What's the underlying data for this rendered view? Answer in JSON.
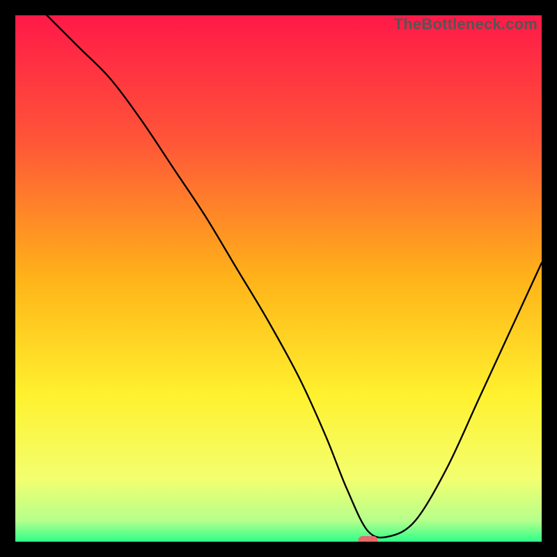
{
  "watermark": "TheBottleneck.com",
  "chart_data": {
    "type": "line",
    "title": "",
    "xlabel": "",
    "ylabel": "",
    "xlim": [
      0,
      100
    ],
    "ylim": [
      0,
      100
    ],
    "grid": false,
    "legend": false,
    "background_gradient_stops": [
      {
        "offset": 0.0,
        "color": "#ff1948"
      },
      {
        "offset": 0.24,
        "color": "#ff5638"
      },
      {
        "offset": 0.5,
        "color": "#ffb319"
      },
      {
        "offset": 0.72,
        "color": "#fff12e"
      },
      {
        "offset": 0.88,
        "color": "#f3ff6f"
      },
      {
        "offset": 0.96,
        "color": "#b6ff8c"
      },
      {
        "offset": 1.0,
        "color": "#2cff8a"
      }
    ],
    "optimal_marker": {
      "x": 67,
      "y": 0,
      "color": "#e86a6a"
    },
    "series": [
      {
        "name": "bottleneck-curve",
        "color": "#000000",
        "x": [
          0,
          6,
          12,
          18,
          24,
          30,
          36,
          42,
          48,
          54,
          59,
          63,
          67,
          71,
          76,
          82,
          88,
          94,
          100
        ],
        "y": [
          106,
          100,
          94,
          88,
          80,
          71,
          62,
          52,
          42,
          31,
          20,
          10,
          2,
          1,
          4,
          14,
          27,
          40,
          53
        ]
      }
    ]
  }
}
